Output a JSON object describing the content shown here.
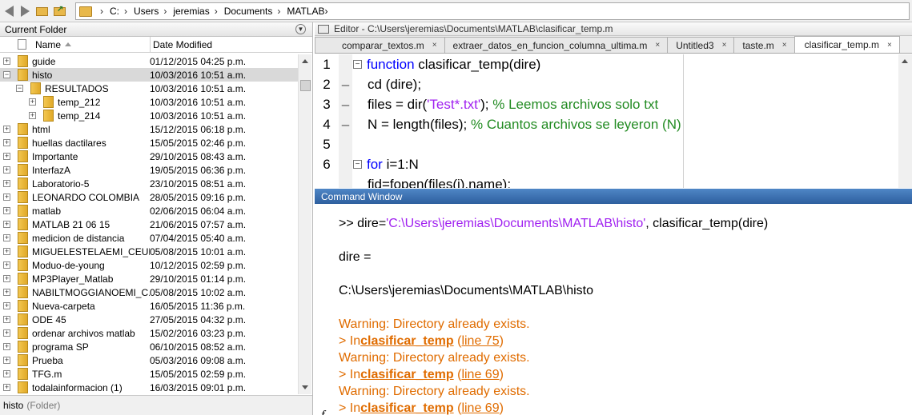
{
  "address_bar": {
    "crumbs": [
      "C:",
      "Users",
      "jeremias",
      "Documents",
      "MATLAB"
    ]
  },
  "current_folder": {
    "title": "Current Folder",
    "col_name": "Name",
    "col_date": "Date Modified",
    "rows": [
      {
        "name": "guide",
        "date": "01/12/2015 04:25 p.m.",
        "exp": "+"
      },
      {
        "name": "histo",
        "date": "10/03/2016 10:51 a.m.",
        "exp": "−"
      },
      {
        "name": "RESULTADOS",
        "date": "10/03/2016 10:51 a.m.",
        "exp": "−"
      },
      {
        "name": "temp_212",
        "date": "10/03/2016 10:51 a.m.",
        "exp": "+"
      },
      {
        "name": "temp_214",
        "date": "10/03/2016 10:51 a.m.",
        "exp": "+"
      },
      {
        "name": "html",
        "date": "15/12/2015 06:18 p.m.",
        "exp": "+"
      },
      {
        "name": "huellas dactilares",
        "date": "15/05/2015 02:46 p.m.",
        "exp": "+"
      },
      {
        "name": "Importante",
        "date": "29/10/2015 08:43 a.m.",
        "exp": "+"
      },
      {
        "name": "InterfazA",
        "date": "19/05/2015 06:36 p.m.",
        "exp": "+"
      },
      {
        "name": "Laboratorio-5",
        "date": "23/10/2015 08:51 a.m.",
        "exp": "+"
      },
      {
        "name": "LEONARDO COLOMBIA",
        "date": "28/05/2015 09:16 p.m.",
        "exp": "+"
      },
      {
        "name": "matlab",
        "date": "02/06/2015 06:04 a.m.",
        "exp": "+"
      },
      {
        "name": "MATLAB 21 06 15",
        "date": "21/06/2015 07:57 a.m.",
        "exp": "+"
      },
      {
        "name": "medicion de distancia",
        "date": "07/04/2015 05:40 a.m.",
        "exp": "+"
      },
      {
        "name": "MIGUELESTELAEMI_CEUP...",
        "date": "05/08/2015 10:01 a.m.",
        "exp": "+"
      },
      {
        "name": "Moduo-de-young",
        "date": "10/12/2015 02:59 p.m.",
        "exp": "+"
      },
      {
        "name": "MP3Player_Matlab",
        "date": "29/10/2015 01:14 p.m.",
        "exp": "+"
      },
      {
        "name": "NABILTMOGGIANOEMI_C...",
        "date": "05/08/2015 10:02 a.m.",
        "exp": "+"
      },
      {
        "name": "Nueva-carpeta",
        "date": "16/05/2015 11:36 p.m.",
        "exp": "+"
      },
      {
        "name": "ODE 45",
        "date": "27/05/2015 04:32 p.m.",
        "exp": "+"
      },
      {
        "name": "ordenar archivos matlab",
        "date": "15/02/2016 03:23 p.m.",
        "exp": "+"
      },
      {
        "name": "programa SP",
        "date": "06/10/2015 08:52 a.m.",
        "exp": "+"
      },
      {
        "name": "Prueba",
        "date": "05/03/2016 09:08 a.m.",
        "exp": "+"
      },
      {
        "name": "TFG.m",
        "date": "15/05/2015 02:59 p.m.",
        "exp": "+"
      },
      {
        "name": "todalainformacion (1)",
        "date": "16/03/2015 09:01 p.m.",
        "exp": "+"
      }
    ],
    "status_name": "histo",
    "status_type": "(Folder)"
  },
  "editor": {
    "title": "Editor - C:\\Users\\jeremias\\Documents\\MATLAB\\clasificar_temp.m",
    "tabs": [
      "comparar_textos.m",
      "extraer_datos_en_funcion_columna_ultima.m",
      "Untitled3",
      "taste.m",
      "clasificar_temp.m"
    ],
    "tab_close": "×",
    "lines": [
      {
        "n": "1",
        "mark": "",
        "fold": "−"
      },
      {
        "n": "2",
        "mark": "–",
        "fold": ""
      },
      {
        "n": "3",
        "mark": "–",
        "fold": ""
      },
      {
        "n": "4",
        "mark": "–",
        "fold": ""
      },
      {
        "n": "5",
        "mark": "",
        "fold": ""
      },
      {
        "n": "6",
        "mark": "–",
        "fold": "−"
      }
    ],
    "code": {
      "l1_kw": "function",
      "l1_rest": " clasificar_temp(dire)",
      "l2": "cd (dire);",
      "l3_a": "files = dir(",
      "l3_str": "'Test*.txt'",
      "l3_b": "); ",
      "l3_cmt": "% Leemos archivos solo txt",
      "l4_a": "N = length(files); ",
      "l4_cmt": "% Cuantos archivos se leyeron (N)",
      "l6_kw": "for",
      "l6_rest": " i=1:N",
      "l7": "fid=fopen(files(i).name);"
    }
  },
  "command_window": {
    "title": "Command Window",
    "prompt": ">> dire=",
    "prompt_str": "'C:\\Users\\jeremias\\Documents\\MATLAB\\histo'",
    "prompt_rest": ", clasificar_temp(dire)",
    "dire_eq": "dire =",
    "dire_val": "C:\\Users\\jeremias\\Documents\\MATLAB\\histo",
    "warnings": [
      {
        "msg": "Warning: Directory already exists.",
        "in": "> In ",
        "fn": "clasificar_temp",
        "line": "line 75"
      },
      {
        "msg": "Warning: Directory already exists.",
        "in": "> In ",
        "fn": "clasificar_temp",
        "line": "line 69"
      },
      {
        "msg": "Warning: Directory already exists.",
        "in": "> In ",
        "fn": "clasificar_temp",
        "line": "line 69"
      }
    ],
    "fx": "f"
  }
}
